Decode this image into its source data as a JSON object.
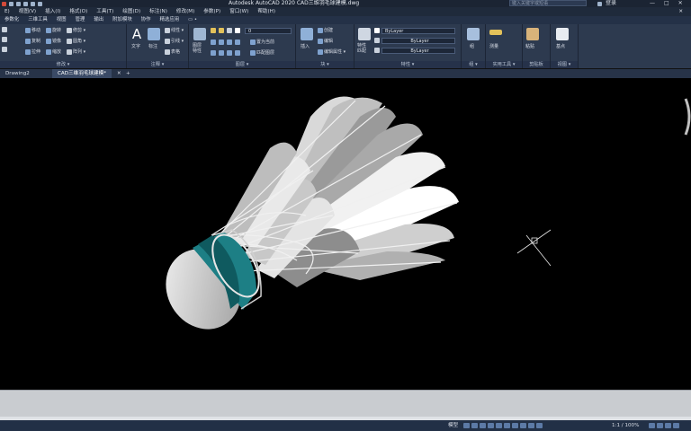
{
  "titlebar": {
    "app_title": "Autodesk AutoCAD 2020    CAD三维羽毛球建模.dwg",
    "search_placeholder": "键入关键字或短语",
    "user_label": "登录",
    "window_controls": [
      "—",
      "□",
      "✕"
    ]
  },
  "menubar": {
    "items": [
      "E)",
      "视图(V)",
      "插入(I)",
      "格式(O)",
      "工具(T)",
      "绘图(D)",
      "标注(N)",
      "修改(M)",
      "参数(P)",
      "窗口(W)",
      "帮助(H)"
    ]
  },
  "ribbon_tabs": {
    "items": [
      "参数化",
      "三维工具",
      "视图",
      "管理",
      "输出",
      "附加模块",
      "协作",
      "精选应用",
      "▭ •"
    ]
  },
  "ribbon": {
    "modify": {
      "title": "修改 ▾",
      "row1": [
        "移动",
        "旋转",
        "修剪 ▾"
      ],
      "row2": [
        "复制",
        "镜像",
        "圆角 ▾"
      ],
      "row3": [
        "拉伸",
        "缩放",
        "阵列 ▾"
      ]
    },
    "annotation": {
      "title": "注释 ▾",
      "text_label": "文字",
      "dim_label": "标注",
      "items": [
        "线性 ▾",
        "引线 ▾",
        "表格"
      ]
    },
    "layers": {
      "title": "图层 ▾",
      "big_label": "图层\n特性",
      "combo_value": "0",
      "items": [
        "置为当前",
        "匹配图层"
      ]
    },
    "block": {
      "title": "块 ▾",
      "insert_label": "插入",
      "items": [
        "创建",
        "编辑",
        "编辑属性 ▾"
      ]
    },
    "properties": {
      "title": "特性 ▾",
      "match_label": "特性\n匹配",
      "combos": [
        "ByLayer",
        "ByLayer",
        "ByLayer"
      ]
    },
    "groups": {
      "title": "组 ▾",
      "label": "组"
    },
    "utilities": {
      "title": "实用工具 ▾",
      "label": "测量"
    },
    "clipboard": {
      "title": "剪贴板",
      "label": "粘贴"
    },
    "view": {
      "title": "视图 ▾",
      "label": "基点"
    }
  },
  "doc_tabs": {
    "tabs": [
      "Drawing2",
      "CAD三维羽毛球建模*"
    ],
    "add": "+"
  },
  "viewport": {
    "object": "badminton-shuttlecock-3d-model",
    "background": "#000000"
  },
  "statusbar": {
    "model_label": "模型",
    "scale_label": "1:1 / 100%",
    "items": [
      "#",
      "∷",
      "↳",
      "◎",
      "∠",
      "⌖",
      "⊞",
      "▣",
      "≡",
      "⚙",
      "✚",
      "✎",
      "⛶",
      "☰"
    ]
  },
  "colors": {
    "ribbon_bg": "#2d3a4f",
    "title_bg": "#1b2433",
    "cork_band": "#1d7f85",
    "feather_light": "#e6e6e6",
    "feather_dark": "#8a8a8a"
  }
}
